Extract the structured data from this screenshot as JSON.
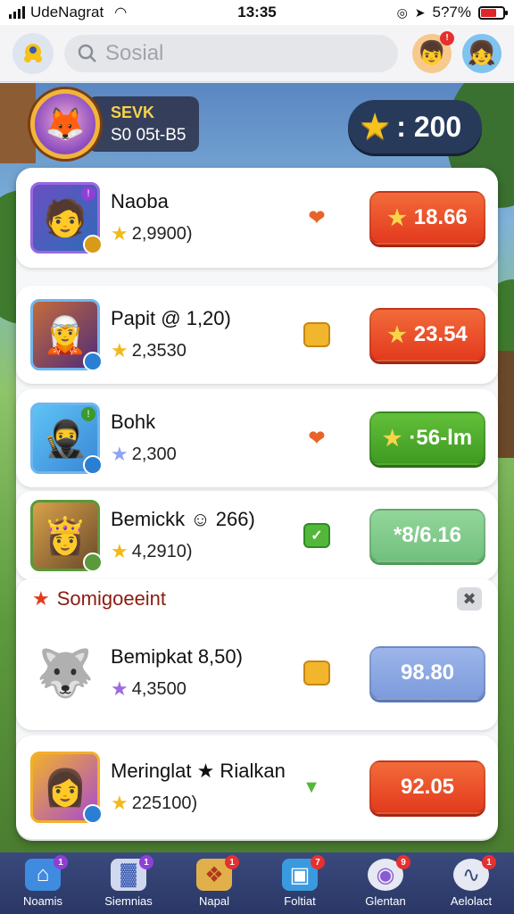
{
  "status_bar": {
    "carrier": "UdeNagrat",
    "time": "13:35",
    "battery": "5?7%"
  },
  "header": {
    "search_placeholder": "Sosial"
  },
  "profile": {
    "level": "SEVK",
    "id": "S0 05t-B5"
  },
  "coins": {
    "amount": ": 200"
  },
  "players": [
    {
      "name": "Naoba",
      "score": "2,9900)",
      "price": "18.66",
      "price_style": "red",
      "status": "chevron"
    },
    {
      "name": "Papit @ 1,20)",
      "score": "2,3530",
      "price": "23.54",
      "price_style": "red",
      "status": "check-yellow"
    },
    {
      "name": "Bohk",
      "score": "2,300",
      "price": "·56-lm",
      "price_style": "green",
      "status": "chevron"
    },
    {
      "name": "Bemickk ☺ 266)",
      "score": "4,2910)",
      "price": "*8/6.16",
      "price_style": "lgreen",
      "status": "check"
    }
  ],
  "section": {
    "title": "Somigoeeint",
    "rows": [
      {
        "name": "Bemipkat  8,50)",
        "score": "4,3500",
        "price": "98.80",
        "price_style": "blue",
        "status": "check-yellow"
      }
    ]
  },
  "last_row": {
    "name": "Meringlat ★ Rialkan",
    "score": "225100)",
    "price": "92.05",
    "price_style": "red",
    "status": "chevron-green"
  },
  "nav": [
    {
      "label": "Noamis",
      "badge": "1"
    },
    {
      "label": "Siemnias",
      "badge": "1"
    },
    {
      "label": "Napal",
      "badge": "1"
    },
    {
      "label": "Foltiat",
      "badge": "7"
    },
    {
      "label": "Glentan",
      "badge": "9"
    },
    {
      "label": "Aelolact",
      "badge": "1"
    }
  ],
  "colors": {
    "accent_red": "#e33a1e",
    "accent_green": "#3f9a22",
    "nav_bg": "#2a3766",
    "star": "#f2b91c"
  }
}
